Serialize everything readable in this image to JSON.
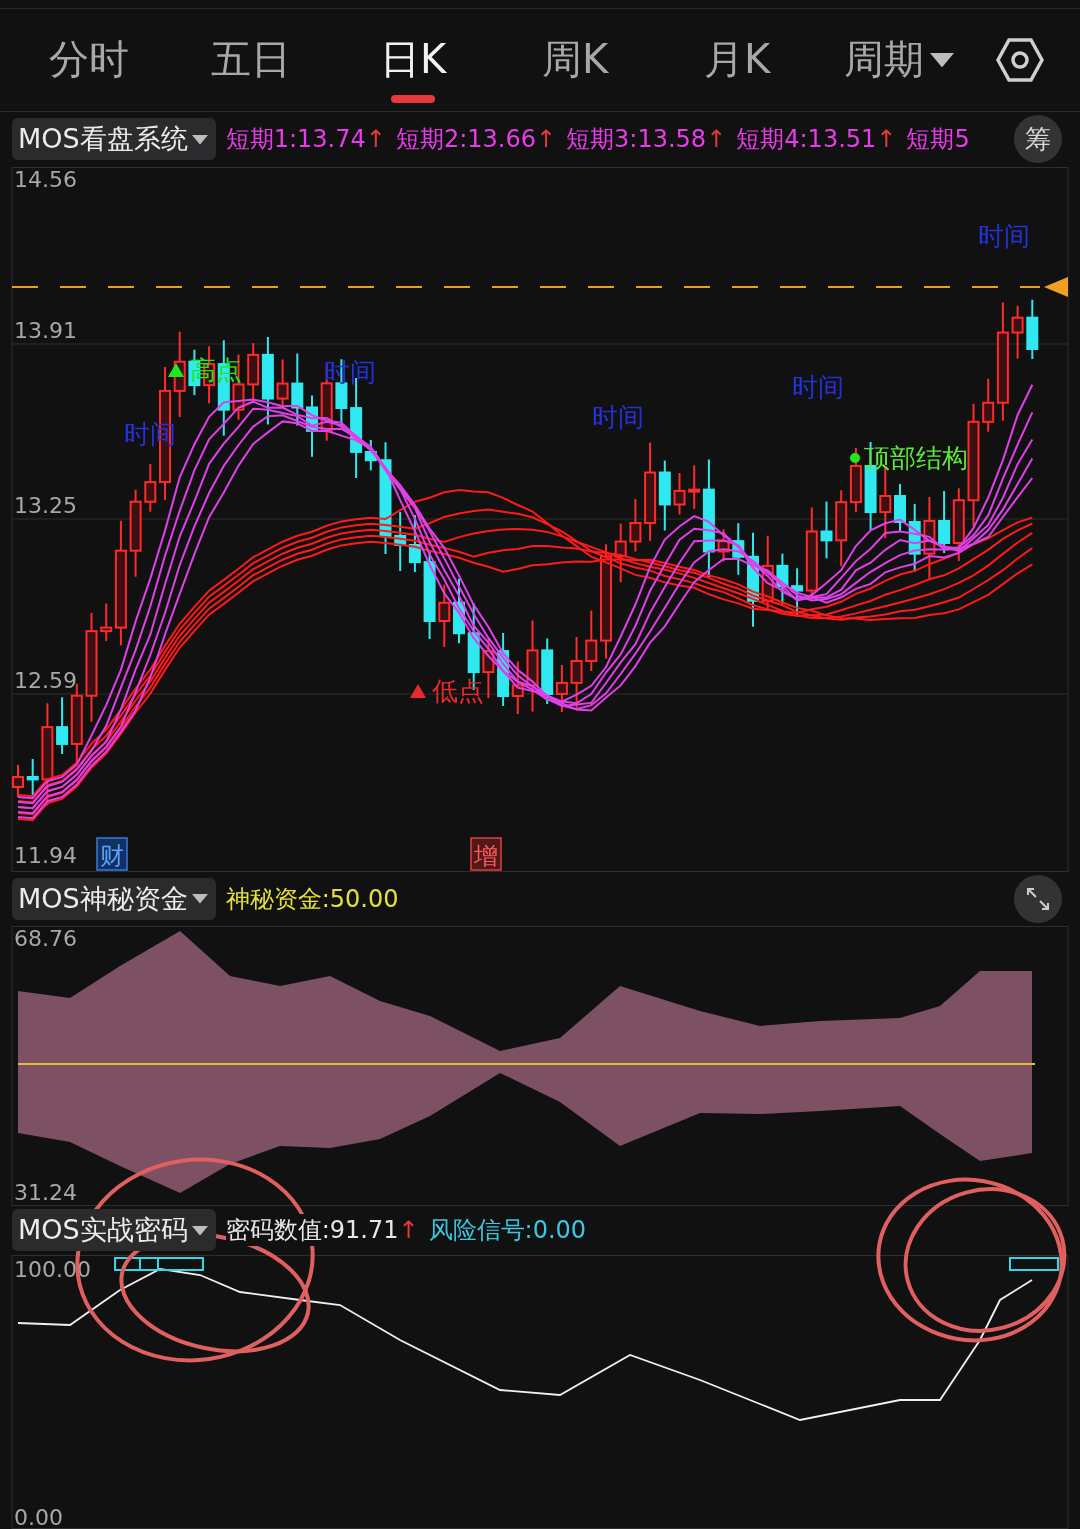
{
  "tabs": [
    {
      "label": "分时",
      "selected": false,
      "kind": "plain"
    },
    {
      "label": "五日",
      "selected": false,
      "kind": "plain"
    },
    {
      "label": "日K",
      "selected": true,
      "kind": "plain"
    },
    {
      "label": "周K",
      "selected": false,
      "kind": "plain"
    },
    {
      "label": "月K",
      "selected": false,
      "kind": "plain"
    },
    {
      "label": "周期",
      "selected": false,
      "kind": "dropdown"
    }
  ],
  "panels": [
    {
      "kind": "candles",
      "indicator": "MOS看盘系统",
      "side_button": "筹",
      "readings": [
        {
          "label": "短期1:",
          "value": "13.74",
          "arrow": "↑",
          "color": "#e83ce8"
        },
        {
          "label": "短期2:",
          "value": "13.66",
          "arrow": "↑",
          "color": "#e83ce8"
        },
        {
          "label": "短期3:",
          "value": "13.58",
          "arrow": "↑",
          "color": "#e83ce8"
        },
        {
          "label": "短期4:",
          "value": "13.51",
          "arrow": "↑",
          "color": "#e83ce8"
        },
        {
          "label": "短期5",
          "color": "#e83ce8"
        }
      ],
      "y_labels": [
        "14.56",
        "13.91",
        "13.25",
        "12.59",
        "11.94"
      ],
      "chart_marks": [
        {
          "kind": "high",
          "text": "高点"
        },
        {
          "kind": "time",
          "text": "时间"
        },
        {
          "kind": "time",
          "text": "时间"
        },
        {
          "kind": "time",
          "text": "时间"
        },
        {
          "kind": "time",
          "text": "时间"
        },
        {
          "kind": "time",
          "text": "时间"
        },
        {
          "kind": "low",
          "text": "低点"
        },
        {
          "kind": "structure",
          "text": "顶部结构"
        },
        {
          "kind": "finance",
          "text": "财"
        },
        {
          "kind": "increase",
          "text": "增"
        }
      ]
    },
    {
      "kind": "area",
      "indicator": "MOS神秘资金",
      "readings": [
        {
          "label": "神秘资金:",
          "value": "50.00",
          "color": "#e6e03a"
        }
      ],
      "y_labels": [
        "68.76",
        "31.24"
      ]
    },
    {
      "kind": "line",
      "indicator": "MOS实战密码",
      "readings": [
        {
          "label": "密码数值:",
          "value": "91.71",
          "arrow": "↑",
          "color": "#e8e8e8"
        },
        {
          "label": "风险信号:",
          "value": "0.00",
          "color": "#3cc8e0"
        }
      ],
      "y_labels": [
        "100.00",
        "0.00"
      ]
    }
  ]
}
